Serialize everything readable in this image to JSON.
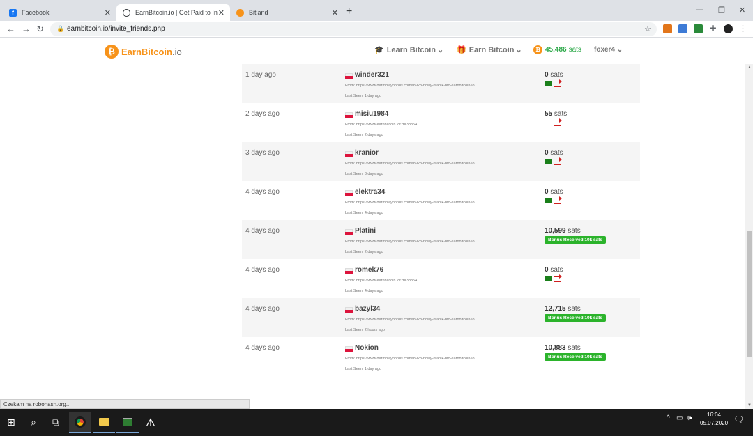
{
  "browser": {
    "tabs": [
      {
        "title": "Facebook",
        "favicon_color": "#1877f2",
        "favicon_glyph": "f"
      },
      {
        "title": "EarnBitcoin.io | Get Paid to Invite",
        "favicon_color": "#ffffff",
        "favicon_glyph": "◉"
      },
      {
        "title": "Bitland",
        "favicon_color": "#f7931a",
        "favicon_glyph": "◎"
      }
    ],
    "url": "earnbitcoin.io/invite_friends.php"
  },
  "site": {
    "logo_earn": "Earn",
    "logo_bitcoin": "Bitcoin",
    "logo_io": ".io",
    "menu": [
      {
        "label": "Learn Bitcoin",
        "icon": "graduation-cap-icon",
        "glyph": "🎓"
      },
      {
        "label": "Earn Bitcoin",
        "icon": "gift-icon",
        "glyph": "🎁"
      }
    ],
    "balance": "45,486",
    "balance_unit": "sats",
    "username": "foxer4"
  },
  "referrals": [
    {
      "when": "1 day ago",
      "user": "winder321",
      "from": "From: https://www.darmowybonus.com/t8923-nowy-kranik-bto-earnbitcoin-io",
      "seen": "Last Seen: 1 day ago",
      "sats": "0",
      "bonus": "",
      "contacted": false
    },
    {
      "when": "2 days ago",
      "user": "misiu1984",
      "from": "From: https://www.earnbitcoin.io/?r=38354",
      "seen": "Last Seen: 2 days ago",
      "sats": "55",
      "bonus": "",
      "contacted": true
    },
    {
      "when": "3 days ago",
      "user": "kranior",
      "from": "From: https://www.darmowybonus.com/t8923-nowy-kranik-bto-earnbitcoin-io",
      "seen": "Last Seen: 3 days ago",
      "sats": "0",
      "bonus": "",
      "contacted": false
    },
    {
      "when": "4 days ago",
      "user": "elektra34",
      "from": "From: https://www.darmowybonus.com/t8923-nowy-kranik-bto-earnbitcoin-io",
      "seen": "Last Seen: 4 days ago",
      "sats": "0",
      "bonus": "",
      "contacted": false
    },
    {
      "when": "4 days ago",
      "user": "Platini",
      "from": "From: https://www.darmowybonus.com/t8923-nowy-kranik-bto-earnbitcoin-io",
      "seen": "Last Seen: 2 days ago",
      "sats": "10,599",
      "bonus": "Bonus Received 10k sats",
      "contacted": false
    },
    {
      "when": "4 days ago",
      "user": "romek76",
      "from": "From: https://www.earnbitcoin.io/?r=38354",
      "seen": "Last Seen: 4 days ago",
      "sats": "0",
      "bonus": "",
      "contacted": false
    },
    {
      "when": "4 days ago",
      "user": "bazyl34",
      "from": "From: https://www.darmowybonus.com/t8923-nowy-kranik-bto-earnbitcoin-io",
      "seen": "Last Seen: 2 hours ago",
      "sats": "12,715",
      "bonus": "Bonus Received 10k sats",
      "contacted": false
    },
    {
      "when": "4 days ago",
      "user": "Nokion",
      "from": "From: https://www.darmowybonus.com/t8923-nowy-kranik-bto-earnbitcoin-io",
      "seen": "Last Seen: 1 day ago",
      "sats": "10,883",
      "bonus": "Bonus Received 10k sats",
      "contacted": false
    }
  ],
  "sats_unit": "sats",
  "status_text": "Czekam na robohash.org...",
  "taskbar": {
    "time": "16:04",
    "date": "05.07.2020"
  },
  "colors": {
    "accent": "#f7931a",
    "success": "#28a745",
    "flag_red": "#dc143c"
  }
}
